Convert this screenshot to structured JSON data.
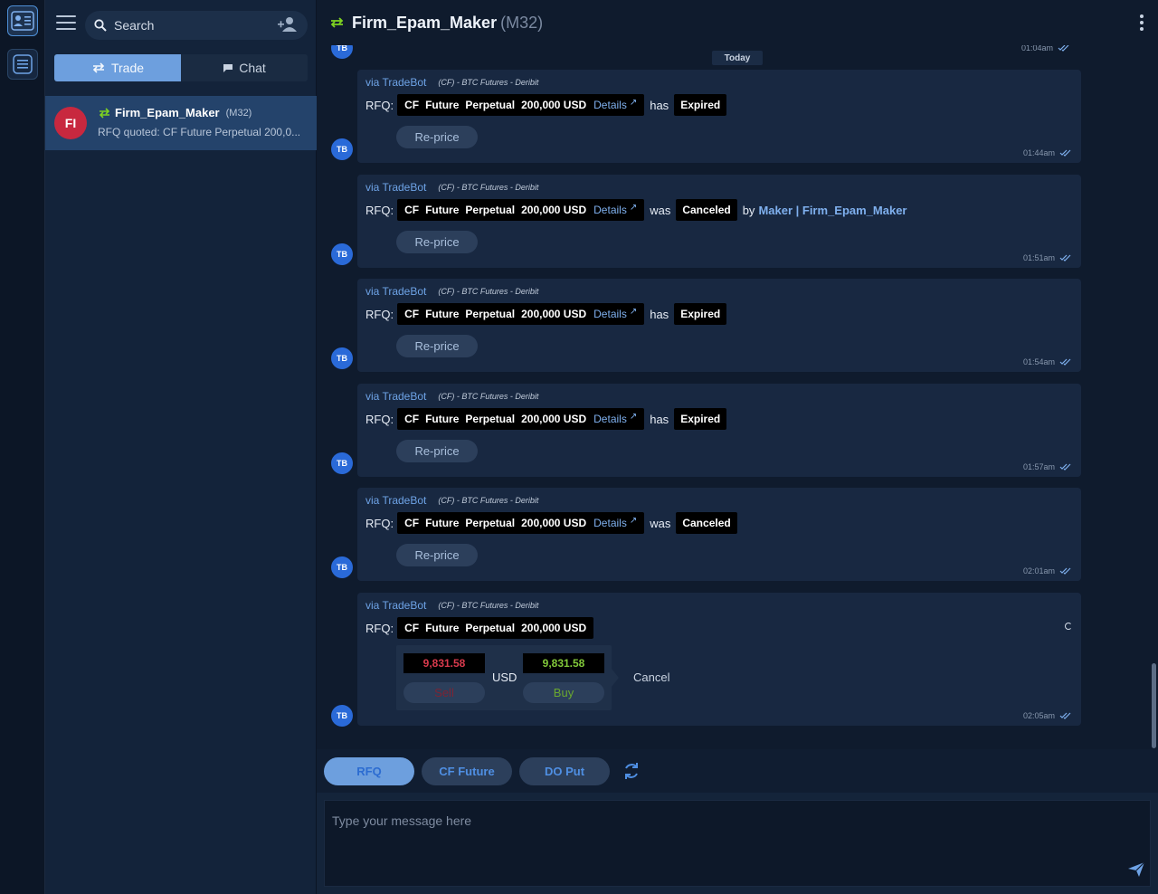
{
  "sidebar": {
    "search_placeholder": "Search",
    "tabs": [
      {
        "label": "Trade",
        "active": true
      },
      {
        "label": "Chat",
        "active": false
      }
    ],
    "conversation": {
      "avatar": "FI",
      "avatar_color": "#c8283f",
      "name": "Firm_Epam_Maker",
      "code": "(M32)",
      "preview": "RFQ quoted: CF Future Perpetual 200,0..."
    }
  },
  "header": {
    "title": "Firm_Epam_Maker",
    "subtitle": "(M32)"
  },
  "thread": {
    "day_divider": "Today",
    "top_partial": {
      "avatar": "TB",
      "time": "01:04am"
    },
    "messages": [
      {
        "avatar": "TB",
        "via": "via TradeBot",
        "source": "(CF) - BTC Futures - Deribit",
        "rfq_label": "RFQ:",
        "words": [
          "CF",
          "Future",
          "Perpetual",
          "200,000 USD"
        ],
        "details": "Details",
        "verb": "has",
        "status": "Expired",
        "action": "Re-price",
        "time": "01:44am"
      },
      {
        "avatar": "TB",
        "via": "via TradeBot",
        "source": "(CF) - BTC Futures - Deribit",
        "rfq_label": "RFQ:",
        "words": [
          "CF",
          "Future",
          "Perpetual",
          "200,000 USD"
        ],
        "details": "Details",
        "verb": "was",
        "status": "Canceled",
        "by_label": "by",
        "by_name": "Maker | Firm_Epam_Maker",
        "action": "Re-price",
        "time": "01:51am"
      },
      {
        "avatar": "TB",
        "via": "via TradeBot",
        "source": "(CF) - BTC Futures - Deribit",
        "rfq_label": "RFQ:",
        "words": [
          "CF",
          "Future",
          "Perpetual",
          "200,000 USD"
        ],
        "details": "Details",
        "verb": "has",
        "status": "Expired",
        "action": "Re-price",
        "time": "01:54am"
      },
      {
        "avatar": "TB",
        "via": "via TradeBot",
        "source": "(CF) - BTC Futures - Deribit",
        "rfq_label": "RFQ:",
        "words": [
          "CF",
          "Future",
          "Perpetual",
          "200,000 USD"
        ],
        "details": "Details",
        "verb": "has",
        "status": "Expired",
        "action": "Re-price",
        "time": "01:57am"
      },
      {
        "avatar": "TB",
        "via": "via TradeBot",
        "source": "(CF) - BTC Futures - Deribit",
        "rfq_label": "RFQ:",
        "words": [
          "CF",
          "Future",
          "Perpetual",
          "200,000 USD"
        ],
        "details": "Details",
        "verb": "was",
        "status": "Canceled",
        "action": "Re-price",
        "time": "02:01am"
      }
    ],
    "quote": {
      "avatar": "TB",
      "via": "via TradeBot",
      "source": "(CF) - BTC Futures - Deribit",
      "rfq_label": "RFQ:",
      "words": [
        "CF",
        "Future",
        "Perpetual",
        "200,000 USD"
      ],
      "sell_price": "9,831.58",
      "buy_price": "9,831.58",
      "currency": "USD",
      "sell_label": "Sell",
      "buy_label": "Buy",
      "cancel_label": "Cancel",
      "time": "02:05am"
    }
  },
  "toolbar": {
    "buttons": [
      "RFQ",
      "CF Future",
      "DO Put"
    ]
  },
  "composer": {
    "placeholder": "Type your message here"
  },
  "colors": {
    "accent": "#6d9fde",
    "sell": "#d93a4d",
    "buy": "#82c93a",
    "link": "#7fb0ee",
    "bot_avatar": "#2a6ad8"
  }
}
